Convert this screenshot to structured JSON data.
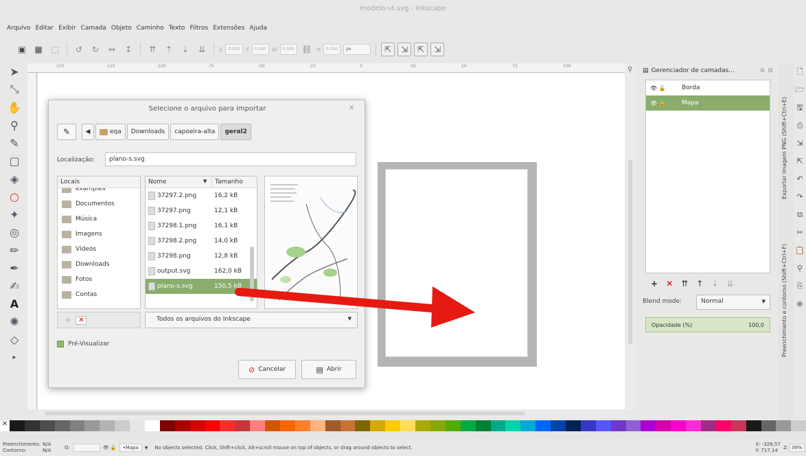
{
  "window": {
    "title": "modelo-vt.svg - Inkscape"
  },
  "menu": [
    "Arquivo",
    "Editar",
    "Exibir",
    "Camada",
    "Objeto",
    "Caminho",
    "Texto",
    "Filtros",
    "Extensões",
    "Ajuda"
  ],
  "toolbar": {
    "x_value": "0,000",
    "y_value": "0,000",
    "w_value": "0,000",
    "h_value": "0,000",
    "unit": "px"
  },
  "ruler_labels": [
    "-150",
    "-125",
    "-100",
    "-75",
    "-50",
    "-25",
    "0",
    "25",
    "50",
    "75",
    "100"
  ],
  "dialog": {
    "title": "Selecione o arquivo para importar",
    "breadcrumbs": [
      "eqa",
      "Downloads",
      "capoeira-alta",
      "geral2"
    ],
    "location_label": "Localização:",
    "location_value": "plano-s.svg",
    "places_header": "Locais",
    "places": [
      "examples",
      "Documentos",
      "Música",
      "Imagens",
      "Vídeos",
      "Downloads",
      "Fotos",
      "Contas"
    ],
    "files_header_name": "Nome",
    "files_header_size": "Tamanho",
    "files": [
      {
        "name": "37297.2.png",
        "size": "16,2 kB"
      },
      {
        "name": "37297.png",
        "size": "12,1 kB"
      },
      {
        "name": "37298.1.png",
        "size": "16,1 kB"
      },
      {
        "name": "37298.2.png",
        "size": "14,0 kB"
      },
      {
        "name": "37298.png",
        "size": "12,8 kB"
      },
      {
        "name": "output.svg",
        "size": "162,0 kB"
      },
      {
        "name": "plano-s.svg",
        "size": "150,5 kB"
      }
    ],
    "filter": "Todos os arquivos do Inkscape",
    "preview_label": "Pré-Visualizar",
    "cancel": "Cancelar",
    "open": "Abrir"
  },
  "layers": {
    "title": "Gerenciador de camadas...",
    "items": [
      {
        "name": "Borda"
      },
      {
        "name": "Mapa"
      }
    ],
    "blend_label": "Blend mode:",
    "blend_value": "Normal",
    "opacity_label": "Opacidade (%)",
    "opacity_value": "100,0"
  },
  "side_tabs": [
    "Exportar Imagem PNG (Shift+Ctrl+E)",
    "Preenchimento e contorno (Shift+Ctrl+F)"
  ],
  "status": {
    "fill_label": "Preenchimento:",
    "fill_value": "N/A",
    "stroke_label": "Contorno:",
    "stroke_value": "N/A",
    "opacity_short": "O:",
    "layer": "•Mapa",
    "message": "No objects selected. Click, Shift+click, Alt+scroll mouse on top of objects, or drag around objects to select.",
    "x": "X: -328,57",
    "y": "Y: 717,14",
    "zoom_label": "Z:",
    "zoom": "39%"
  },
  "colors": {
    "accent": "#8aad6d",
    "arrow": "#e51a10"
  },
  "palette": [
    "#1a1a1a",
    "#333",
    "#4d4d4d",
    "#666",
    "#808080",
    "#999",
    "#b3b3b3",
    "#ccc",
    "#e6e6e6",
    "#fff",
    "#800000",
    "#a00",
    "#d40000",
    "#f00",
    "#ff2a2a",
    "#c83737",
    "#ff8080",
    "#d45500",
    "#f60",
    "#ff7f2a",
    "#ffb380",
    "#a05a2c",
    "#c87137",
    "#806600",
    "#d4aa00",
    "#fc0",
    "#ffdd55",
    "#aa0",
    "#88aa00",
    "#5a0",
    "#00aa44",
    "#008033",
    "#00aa88",
    "#00d4aa",
    "#00aad4",
    "#0066ff",
    "#0044aa",
    "#002255",
    "#3737c8",
    "#5555ff",
    "#7137c8",
    "#8d5fd3",
    "#aa00d4",
    "#d400aa",
    "#ff00cc",
    "#ff2ad4",
    "#a02c89",
    "#ff0066",
    "#c8375a",
    "#1a1a1a",
    "#666",
    "#999",
    "#ccc"
  ]
}
